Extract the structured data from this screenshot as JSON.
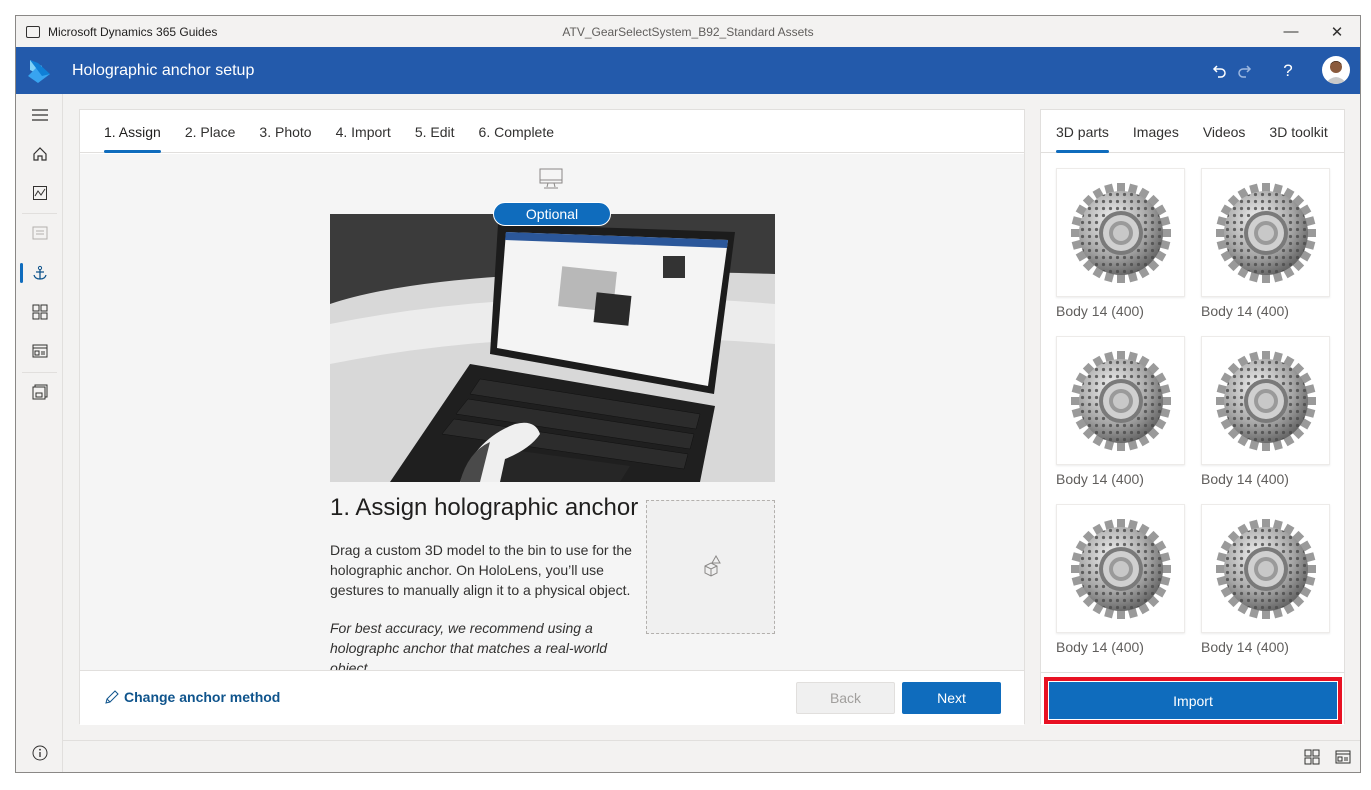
{
  "titlebar": {
    "app_name": "Microsoft Dynamics 365 Guides",
    "document": "ATV_GearSelectSystem_B92_Standard Assets",
    "minimize": "—",
    "close": "✕"
  },
  "header": {
    "title": "Holographic anchor setup",
    "help": "?"
  },
  "steps": [
    "1. Assign",
    "2. Place",
    "3. Photo",
    "4. Import",
    "5. Edit",
    "6. Complete"
  ],
  "main": {
    "badge": "Optional",
    "heading": "1. Assign holographic anchor",
    "description": "Drag a custom 3D model to the bin to use for the holographic anchor. On HoloLens, you’ll use gestures to manually align it to a physical object.",
    "tip": "For best accuracy, we recommend using a holographc anchor that matches a real-world object."
  },
  "footer": {
    "change_method": "Change anchor method",
    "back": "Back",
    "next": "Next"
  },
  "panel": {
    "tabs": [
      "3D parts",
      "Images",
      "Videos",
      "3D toolkit"
    ],
    "items": [
      {
        "label": "Body 14 (400)"
      },
      {
        "label": "Body 14 (400)"
      },
      {
        "label": "Body 14 (400)"
      },
      {
        "label": "Body 14 (400)"
      },
      {
        "label": "Body 14 (400)"
      },
      {
        "label": "Body 14 (400)"
      }
    ],
    "import": "Import"
  },
  "colors": {
    "accent": "#0f6cbd",
    "header": "#235aab",
    "highlight": "#e81123"
  }
}
